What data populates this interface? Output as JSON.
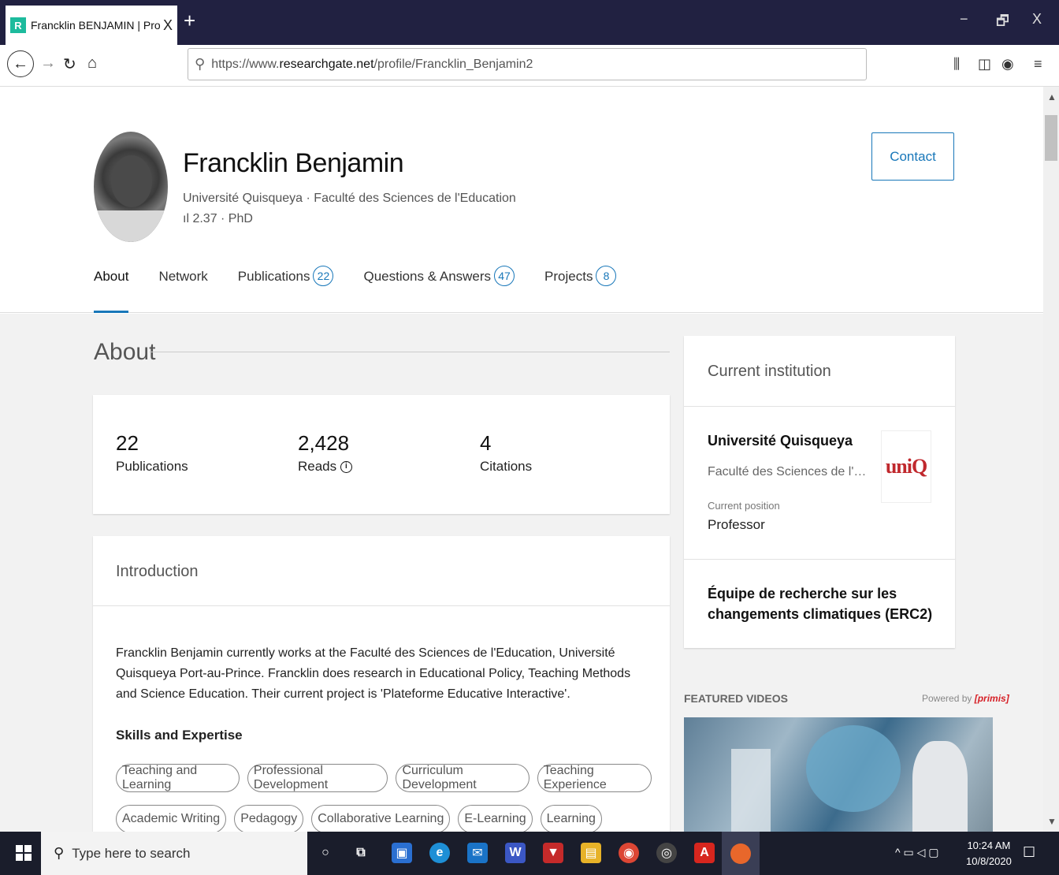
{
  "browser": {
    "tab_title": "Francklin BENJAMIN | Professor",
    "tab_favicon": "R",
    "tab_close": "X",
    "new_tab": "+",
    "window_minimize": "−",
    "window_restore": "🗗",
    "window_close": "X",
    "url_prefix": "https://www.",
    "url_domain": "researchgate.net",
    "url_path": "/profile/Francklin_Benjamin2"
  },
  "profile": {
    "name": "Francklin Benjamin",
    "institution_line": "Université Quisqueya · Faculté des Sciences de l'Education",
    "score_line": "ıl 2.37 · PhD",
    "contact_label": "Contact",
    "tabs": [
      {
        "label": "About",
        "count": null
      },
      {
        "label": "Network",
        "count": null
      },
      {
        "label": "Publications",
        "count": "22"
      },
      {
        "label": "Questions & Answers",
        "count": "47"
      },
      {
        "label": "Projects",
        "count": "8"
      }
    ]
  },
  "about": {
    "title": "About",
    "stats": [
      {
        "value": "22",
        "label": "Publications"
      },
      {
        "value": "2,428",
        "label": "Reads"
      },
      {
        "value": "4",
        "label": "Citations"
      }
    ],
    "intro_title": "Introduction",
    "intro_text": "Francklin Benjamin currently works at the Faculté des Sciences de l'Education, Université Quisqueya Port-au-Prince. Francklin does research in Educational Policy, Teaching Methods and Science Education. Their current project is 'Plateforme Educative Interactive'.",
    "skills_title": "Skills and Expertise",
    "skills_row1": [
      "Teaching and Learning",
      "Professional Development",
      "Curriculum Development",
      "Teaching Experience"
    ],
    "skills_row2": [
      "Academic Writing",
      "Pedagogy",
      "Collaborative Learning",
      "E-Learning",
      "Learning"
    ]
  },
  "institution": {
    "title": "Current institution",
    "name": "Université Quisqueya",
    "department": "Faculté des Sciences de l'Education",
    "position_label": "Current position",
    "position": "Professor",
    "logo_text": "uniQ",
    "group": "Équipe de recherche sur les changements climatiques (ERC2)"
  },
  "video": {
    "label": "FEATURED VIDEOS",
    "powered_prefix": "Powered by",
    "powered_brand": "[primis]"
  },
  "taskbar": {
    "search_placeholder": "Type here to search",
    "time": "10:24 AM",
    "date": "10/8/2020"
  },
  "icons": [
    "back-arrow-icon",
    "forward-arrow-icon",
    "reload-icon",
    "home-icon",
    "search-icon",
    "library-icon",
    "sidebar-icon",
    "account-icon",
    "menu-icon",
    "info-icon",
    "windows-icon"
  ]
}
